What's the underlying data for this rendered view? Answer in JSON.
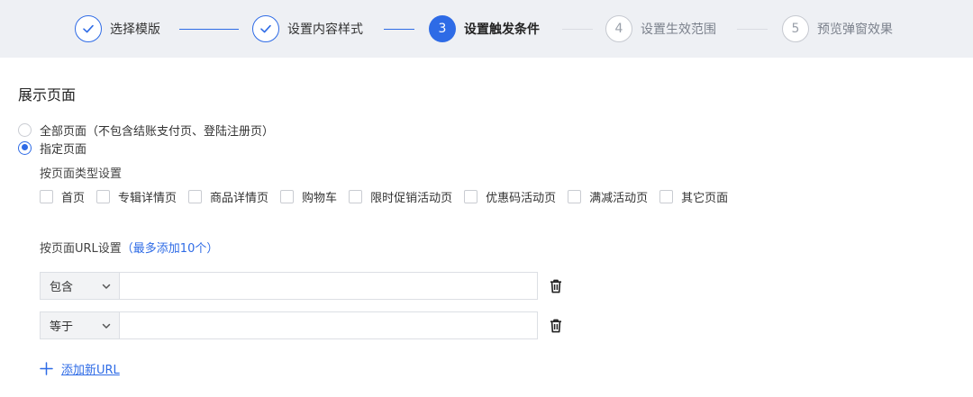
{
  "colors": {
    "accent": "#2e6be6",
    "stepper_bg": "#eef0f4"
  },
  "stepper": {
    "steps": [
      {
        "number": "",
        "label": "选择模版",
        "state": "done",
        "icon": "check-icon"
      },
      {
        "number": "",
        "label": "设置内容样式",
        "state": "done",
        "icon": "check-icon"
      },
      {
        "number": "3",
        "label": "设置触发条件",
        "state": "active"
      },
      {
        "number": "4",
        "label": "设置生效范围",
        "state": "todo"
      },
      {
        "number": "5",
        "label": "预览弹窗效果",
        "state": "todo"
      }
    ]
  },
  "section": {
    "title": "展示页面",
    "radios": [
      {
        "label": "全部页面（不包含结账支付页、登陆注册页）",
        "checked": false
      },
      {
        "label": "指定页面",
        "checked": true
      }
    ],
    "by_type": {
      "title": "按页面类型设置",
      "options": [
        "首页",
        "专辑详情页",
        "商品详情页",
        "购物车",
        "限时促销活动页",
        "优惠码活动页",
        "满减活动页",
        "其它页面"
      ]
    },
    "by_url": {
      "title": "按页面URL设置",
      "hint": "（最多添加10个）",
      "rows": [
        {
          "condition": "包含",
          "value": ""
        },
        {
          "condition": "等于",
          "value": ""
        }
      ],
      "add_label": "添加新URL",
      "add_icon": "plus-icon",
      "delete_icon": "trash-icon",
      "dropdown_icon": "chevron-down-icon"
    }
  }
}
